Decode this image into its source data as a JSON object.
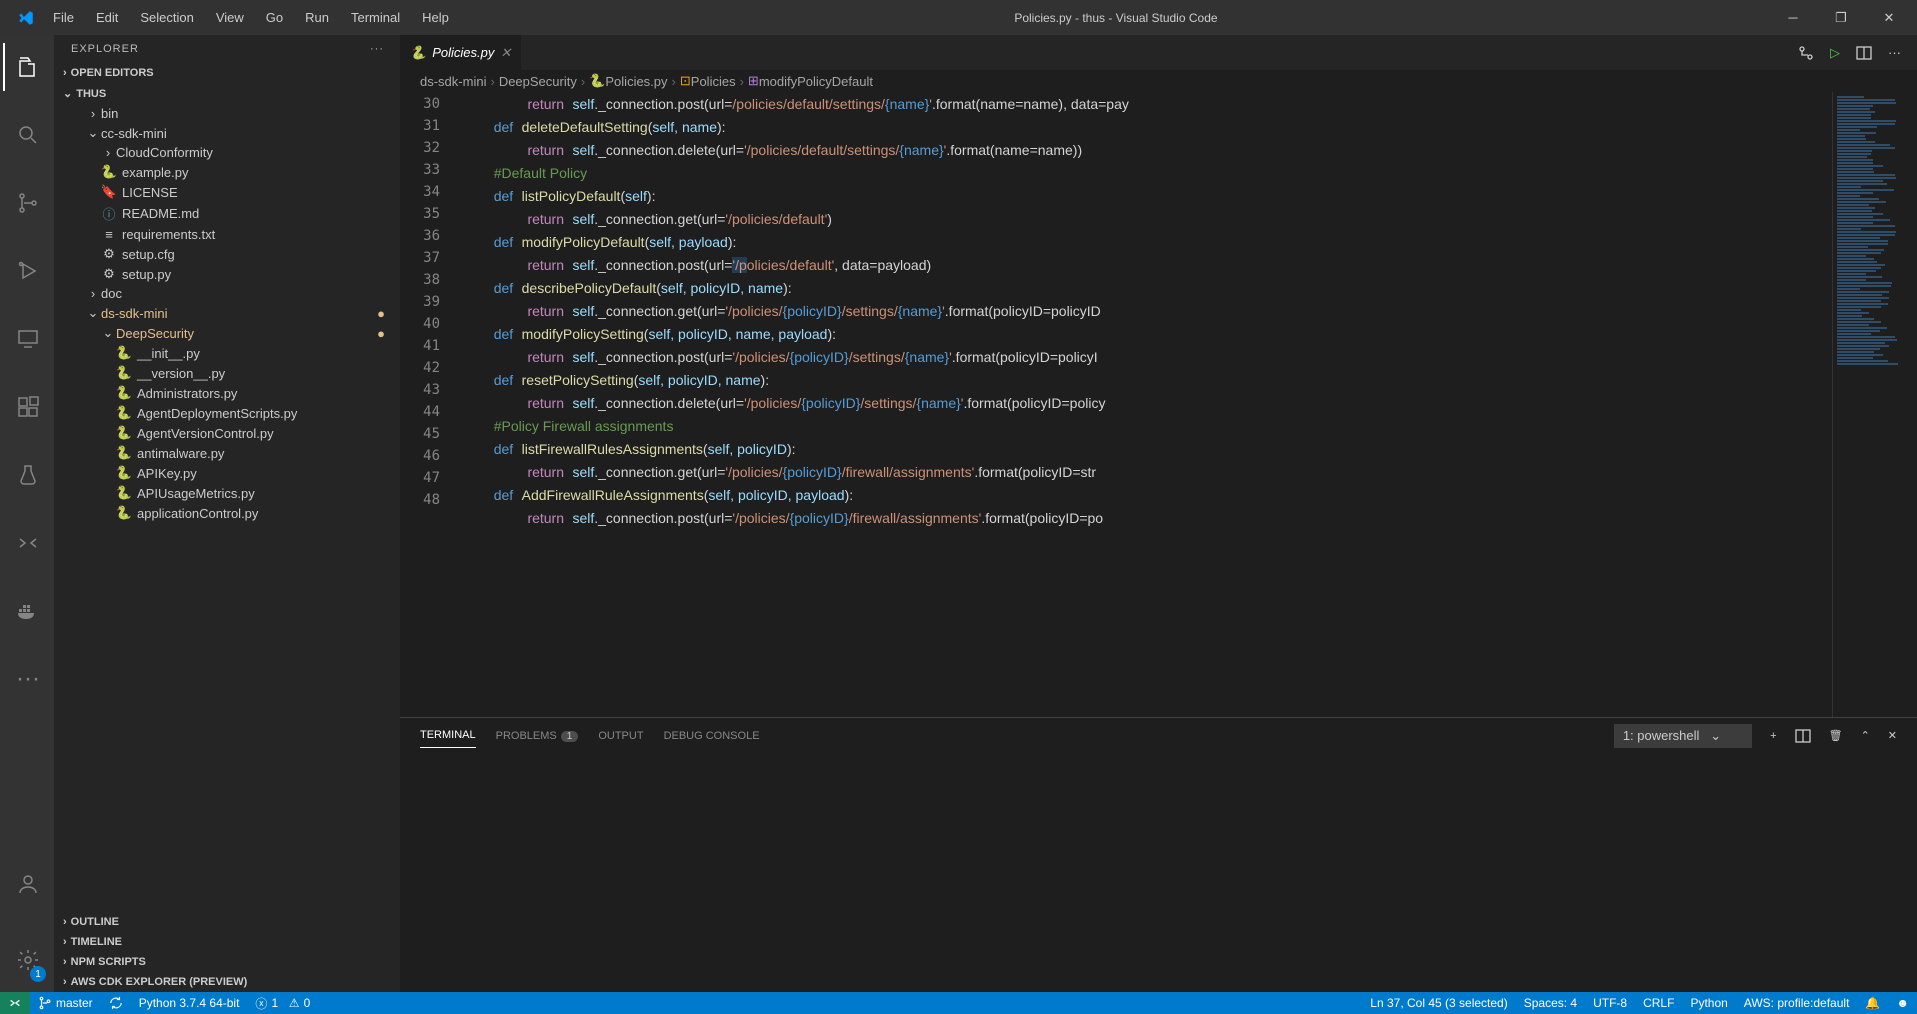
{
  "window_title": "Policies.py - thus - Visual Studio Code",
  "menu": [
    "File",
    "Edit",
    "Selection",
    "View",
    "Go",
    "Run",
    "Terminal",
    "Help"
  ],
  "explorer_label": "EXPLORER",
  "sections": {
    "open_editors": "OPEN EDITORS",
    "workspace": "THUS",
    "outline": "OUTLINE",
    "timeline": "TIMELINE",
    "npm": "NPM SCRIPTS",
    "cdk": "AWS CDK EXPLORER (PREVIEW)"
  },
  "tree": {
    "bin": "bin",
    "ccsdk": "cc-sdk-mini",
    "cloudconf": "CloudConformity",
    "example": "example.py",
    "license": "LICENSE",
    "readme": "README.md",
    "requirements": "requirements.txt",
    "setupcfg": "setup.cfg",
    "setuppy": "setup.py",
    "doc": "doc",
    "dssdk": "ds-sdk-mini",
    "deepsec": "DeepSecurity",
    "init": "__init__.py",
    "version": "__version__.py",
    "admins": "Administrators.py",
    "ads": "AgentDeploymentScripts.py",
    "avc": "AgentVersionControl.py",
    "antimal": "antimalware.py",
    "apikey": "APIKey.py",
    "apiusage": "APIUsageMetrics.py",
    "appctl": "applicationControl.py"
  },
  "tab_name": "Policies.py",
  "breadcrumbs": [
    "ds-sdk-mini",
    "DeepSecurity",
    "Policies.py",
    "Policies",
    "modifyPolicyDefault"
  ],
  "lines": {
    "start": 30,
    "end": 48
  },
  "code": {
    "l30": {
      "ret": "return",
      "self": "self",
      "txt": "._connection.post(url=",
      "str": "/policies/default/settings/",
      "br": "{name}",
      "txt2": ".format(name=name), data=pay"
    },
    "l31": {
      "def": "def",
      "fn": "deleteDefaultSetting",
      "params": "(self, name):"
    },
    "l32": {
      "ret": "return",
      "self": "self",
      "txt": "._connection.delete(url=",
      "str": "'/policies/default/settings/",
      "br": "{name}",
      "str2": "'",
      "txt2": ".format(name=name))"
    },
    "l33": {
      "comment": "#Default Policy"
    },
    "l34": {
      "def": "def",
      "fn": "listPolicyDefault",
      "params": "(self):"
    },
    "l35": {
      "ret": "return",
      "self": "self",
      "txt": "._connection.get(url=",
      "str": "'/policies/default'",
      "txt2": ")"
    },
    "l36": {
      "def": "def",
      "fn": "modifyPolicyDefault",
      "params": "(self, payload):"
    },
    "l37": {
      "ret": "return",
      "self": "self",
      "txt": "._connection.post(url=",
      "str1": "'/p",
      "str2": "olicies/default'",
      "txt2": ", data=payload)"
    },
    "l38": {
      "def": "def",
      "fn": "describePolicyDefault",
      "params": "(self, policyID, name):"
    },
    "l39": {
      "ret": "return",
      "self": "self",
      "txt": "._connection.get(url=",
      "str": "'/policies/",
      "br": "{policyID}",
      "str2": "/settings/",
      "br2": "{name}",
      "str3": "'",
      "txt2": ".format(policyID=policyID"
    },
    "l40": {
      "def": "def",
      "fn": "modifyPolicySetting",
      "params": "(self, policyID, name, payload):"
    },
    "l41": {
      "ret": "return",
      "self": "self",
      "txt": "._connection.post(url=",
      "str": "'/policies/",
      "br": "{policyID}",
      "str2": "/settings/",
      "br2": "{name}",
      "str3": "'",
      "txt2": ".format(policyID=policyI"
    },
    "l42": {
      "def": "def",
      "fn": "resetPolicySetting",
      "params": "(self, policyID, name):"
    },
    "l43": {
      "ret": "return",
      "self": "self",
      "txt": "._connection.delete(url=",
      "str": "'/policies/",
      "br": "{policyID}",
      "str2": "/settings/",
      "br2": "{name}",
      "str3": "'",
      "txt2": ".format(policyID=policy"
    },
    "l44": {
      "comment": "#Policy Firewall assignments"
    },
    "l45": {
      "def": "def",
      "fn": "listFirewallRulesAssignments",
      "params": "(self, policyID):"
    },
    "l46": {
      "ret": "return",
      "self": "self",
      "txt": "._connection.get(url=",
      "str": "'/policies/",
      "br": "{policyID}",
      "str2": "/firewall/assignments'",
      "txt2": ".format(policyID=str"
    },
    "l47": {
      "def": "def",
      "fn": "AddFirewallRuleAssignments",
      "params": "(self, policyID, payload):"
    },
    "l48": {
      "ret": "return",
      "self": "self",
      "txt": "._connection.post(url=",
      "str": "'/policies/",
      "br": "{policyID}",
      "str2": "/firewall/assignments'",
      "txt2": ".format(policyID=po"
    }
  },
  "panel": {
    "terminal": "TERMINAL",
    "problems": "PROBLEMS",
    "problems_count": "1",
    "output": "OUTPUT",
    "debug": "DEBUG CONSOLE",
    "shell": "1: powershell"
  },
  "status": {
    "branch": "master",
    "python": "Python 3.7.4 64-bit",
    "err": "1",
    "warn": "0",
    "pos": "Ln 37, Col 45 (3 selected)",
    "spaces": "Spaces: 4",
    "enc": "UTF-8",
    "eol": "CRLF",
    "lang": "Python",
    "aws": "AWS: profile:default",
    "gear_badge": "1"
  }
}
